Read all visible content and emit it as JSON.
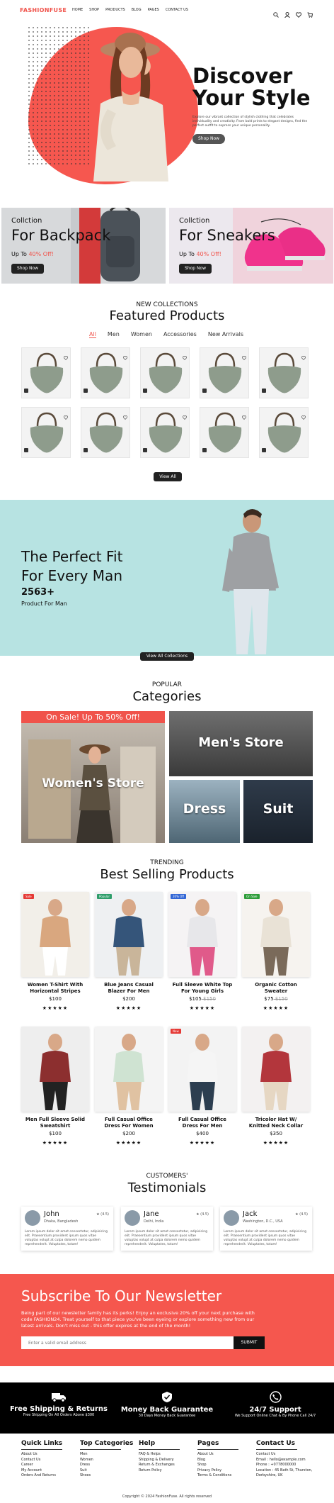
{
  "nav": {
    "logo": "FASHIONFUSE",
    "items": [
      "HOME",
      "SHOP",
      "PRODUCTS",
      "BLOG",
      "PAGES",
      "CONTACT US"
    ]
  },
  "hero": {
    "title_line1": "Discover",
    "title_line2": "Your Style",
    "text": "Explore our vibrant collection of stylish clothing that celebrates individuality and creativity. From bold prints to elegant designs, find the perfect outfit to express your unique personality.",
    "button": "Shop Now"
  },
  "collections": [
    {
      "small": "Collction",
      "big": "For Backpack",
      "upto": "Up To",
      "pct": "40% Off!",
      "button": "Shop Now"
    },
    {
      "small": "Collction",
      "big": "For Sneakers",
      "upto": "Up To",
      "pct": "40% Off!",
      "button": "Shop Now"
    }
  ],
  "featured": {
    "subtitle": "NEW COLLECTIONS",
    "title": "Featured Products",
    "tabs": [
      "All",
      "Men",
      "Women",
      "Accessories",
      "New Arrivals"
    ],
    "button": "View All"
  },
  "fit": {
    "line1": "The Perfect Fit",
    "line2": "For Every Man",
    "number": "2563+",
    "sub": "Product For Man",
    "button": "View All Collections"
  },
  "categories": {
    "subtitle": "POPULAR",
    "title": "Categories",
    "sale": "On Sale! Up To 50% Off!",
    "women": "Women's Store",
    "men": "Men's Store",
    "dress": "Dress",
    "suit": "Suit"
  },
  "bestselling": {
    "subtitle": "TRENDING",
    "title": "Best Selling Products",
    "stars": "★★★★★",
    "products": [
      {
        "badge": "Sale",
        "badge_color": "#e53935",
        "name1": "Women T-Shirt With",
        "name2": "Horizontal Stripes",
        "price": "$100",
        "old": ""
      },
      {
        "badge": "Popular",
        "badge_color": "#2e9d6a",
        "name1": "Blue Jeans Casual",
        "name2": "Blazer For Men",
        "price": "$200",
        "old": ""
      },
      {
        "badge": "20% Off",
        "badge_color": "#3367d6",
        "name1": "Full Sleeve White Top",
        "name2": "For Young Girls",
        "price": "$105",
        "old": "$150"
      },
      {
        "badge": "On Sale",
        "badge_color": "#2e9d3a",
        "name1": "Organic Cotton",
        "name2": "Sweater",
        "price": "$75",
        "old": "$150"
      },
      {
        "badge": "",
        "badge_color": "",
        "name1": "Men Full Sleeve Solid",
        "name2": "Sweatshirt",
        "price": "$100",
        "old": ""
      },
      {
        "badge": "",
        "badge_color": "",
        "name1": "Full Casual Office",
        "name2": "Dress For Women",
        "price": "$200",
        "old": ""
      },
      {
        "badge": "New",
        "badge_color": "#e53935",
        "name1": "Full Casual Office",
        "name2": "Dress For Men",
        "price": "$400",
        "old": ""
      },
      {
        "badge": "",
        "badge_color": "",
        "name1": "Tricolor Hat W/",
        "name2": "Knitted Neck Collar",
        "price": "$350",
        "old": ""
      }
    ]
  },
  "testimonials": {
    "subtitle": "CUSTOMERS'",
    "title": "Testimonials",
    "items": [
      {
        "name": "John",
        "loc": "Dhaka, Bangladesh",
        "rating": "★ (4.5)",
        "text": "Lorem ipsum dolor sit amet consectetur, adipisicing elit. Praesentium provident ipsum quos vitae voluptas volupt at culpa dolorem nemo quidem reprehenderit. Voluptates, totam!"
      },
      {
        "name": "Jane",
        "loc": "Delhi, India",
        "rating": "★ (4.5)",
        "text": "Lorem ipsum dolor sit amet consectetur, adipisicing elit. Praesentium provident ipsum quos vitae voluptas volupt at culpa dolorem nemo quidem reprehenderit. Voluptates, totam!"
      },
      {
        "name": "Jack",
        "loc": "Washington, D.C., USA",
        "rating": "★ (4.5)",
        "text": "Lorem ipsum dolor sit amet consectetur, adipisicing elit. Praesentium provident ipsum quos vitae voluptas volupt at culpa dolorem nemo quidem reprehenderit. Voluptates, totam!"
      }
    ]
  },
  "newsletter": {
    "title": "Subscribe To Our Newsletter",
    "text": "Being part of our newsletter family has its perks! Enjoy an exclusive 20% off your next purchase with code FASHION24. Treat yourself to that piece you've been eyeing or explore something new from our latest arrivals. Don't miss out - this offer expires at the end of the month!",
    "placeholder": "Enter a valid email address",
    "button": "SUBMIT"
  },
  "features": [
    {
      "title": "Free Shipping & Returns",
      "sub": "Free Shipping On All Orders Above $300"
    },
    {
      "title": "Money Back Guarantee",
      "sub": "30 Days Money Back Guarantee"
    },
    {
      "title": "24/7 Support",
      "sub": "We Support Online Chat & By Phone Call 24/7"
    }
  ],
  "footer": {
    "quick": {
      "title": "Quick Links",
      "links": [
        "About Us",
        "Contact Us",
        "Career",
        "My Account",
        "Orders And Returns"
      ]
    },
    "cats": {
      "title": "Top Categories",
      "links": [
        "Men",
        "Women",
        "Dress",
        "Suit",
        "Shoes"
      ]
    },
    "help": {
      "title": "Help",
      "links": [
        "FAQ & Helps",
        "Shipping & Delivery",
        "Return & Exchanges",
        "Return Policy"
      ]
    },
    "pages": {
      "title": "Pages",
      "links": [
        "About Us",
        "Blog",
        "Shop",
        "Privacy Policy",
        "Terms & Conditions"
      ]
    },
    "contact": {
      "title": "Contact Us",
      "links": [
        "Contact Us",
        "Email : hello@example.com",
        "Phone : +0778000000",
        "Location : 45 Bath St, Thurston,",
        "Derbyshire, UK"
      ]
    },
    "copyright": "Copyright © 2024 FashionFuse. All rights reserved"
  }
}
